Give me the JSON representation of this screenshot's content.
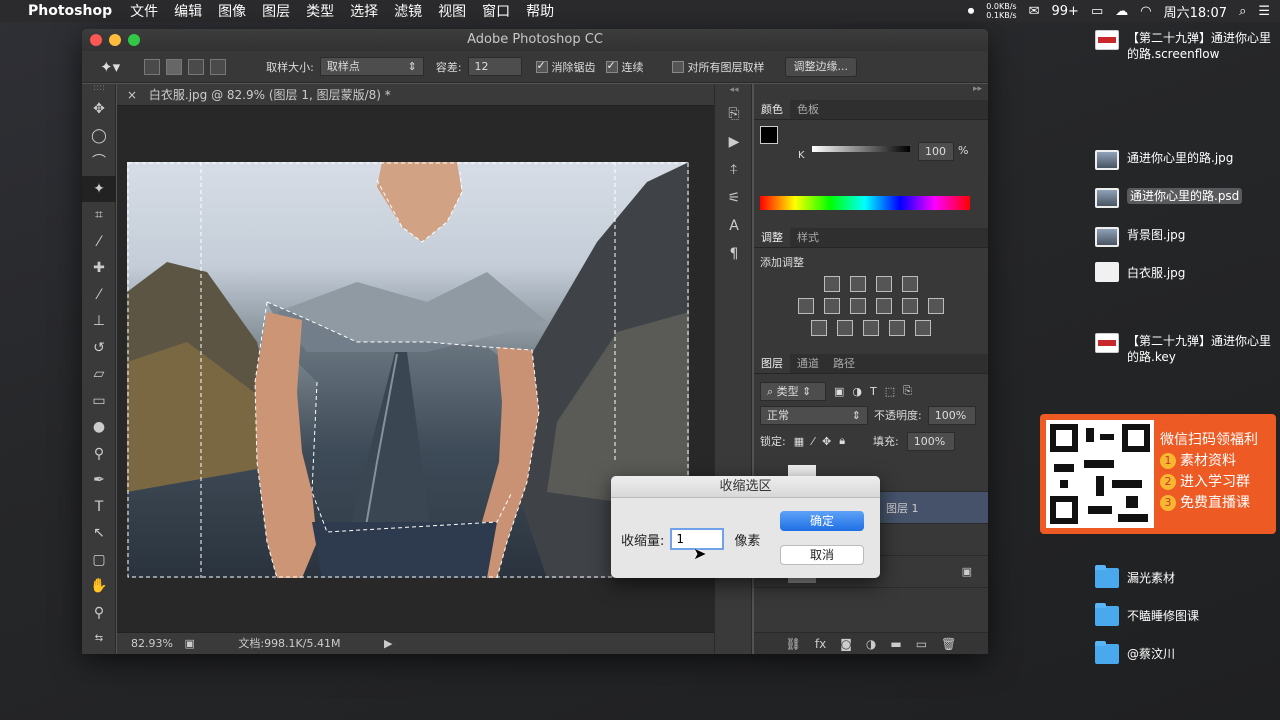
{
  "menubar": {
    "app_name": "Photoshop",
    "menus": [
      "文件",
      "编辑",
      "图像",
      "图层",
      "类型",
      "选择",
      "滤镜",
      "视图",
      "窗口",
      "帮助"
    ],
    "net_up": "0.0KB/s",
    "net_down": "0.1KB/s",
    "badge": "99+",
    "clock": "周六18:07"
  },
  "desktop": {
    "items": [
      {
        "label": "【第二十九弹】通进你心里的路.screenflow"
      },
      {
        "label": "通进你心里的路.jpg"
      },
      {
        "label": "通进你心里的路.psd"
      },
      {
        "label": "背景图.jpg"
      },
      {
        "label": "白衣服.jpg"
      },
      {
        "label": "【第二十九弹】通进你心里的路.key"
      },
      {
        "label": "漏光素材"
      },
      {
        "label": "不瞌睡修图课"
      },
      {
        "label": "@蔡汶川"
      }
    ]
  },
  "promo": {
    "headline": "微信扫码领福利",
    "lines": [
      "素材资料",
      "进入学习群",
      "免费直播课"
    ],
    "nums": [
      "1",
      "2",
      "3"
    ]
  },
  "ps": {
    "window_title": "Adobe Photoshop CC",
    "options": {
      "sample_size_label": "取样大小:",
      "sample_size_value": "取样点",
      "tolerance_label": "容差:",
      "tolerance_value": "12",
      "antialias_label": "消除锯齿",
      "contiguous_label": "连续",
      "all_layers_label": "对所有图层取样",
      "refine_edge_label": "调整边缘..."
    },
    "doc_tab": "白衣服.jpg @ 82.9% (图层 1, 图层蒙版/8) *",
    "status": {
      "zoom": "82.93%",
      "doc_size": "文档:998.1K/5.41M"
    },
    "panels": {
      "color_tabs": [
        "颜色",
        "色板"
      ],
      "k_label": "K",
      "k_value": "100",
      "k_unit": "%",
      "adjust_tabs": [
        "调整",
        "样式"
      ],
      "add_adjustment": "添加调整",
      "layers_tabs": [
        "图层",
        "通道",
        "路径"
      ],
      "kind_filter": "类型",
      "blend_mode": "正常",
      "opacity_label": "不透明度:",
      "opacity_value": "100%",
      "lock_label": "锁定:",
      "fill_label": "填充:",
      "fill_value": "100%",
      "layer_name": "图层 1",
      "bg_layer_name": "背景"
    },
    "dialog": {
      "title": "收缩选区",
      "amount_label": "收缩量:",
      "amount_value": "1",
      "unit": "像素",
      "ok_label": "确定",
      "cancel_label": "取消"
    }
  },
  "colors": {
    "accent_blue": "#1f6fe5",
    "promo_orange": "#ee5a24",
    "folder_blue": "#4aa8ec"
  }
}
